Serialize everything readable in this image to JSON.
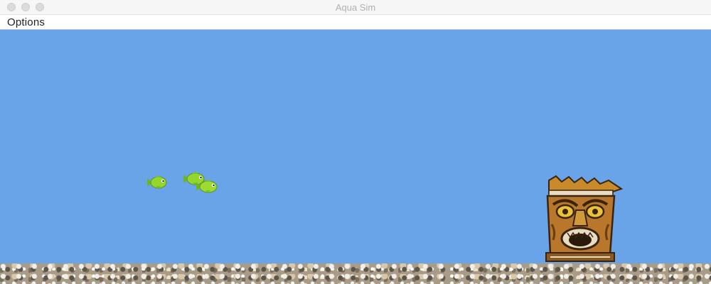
{
  "window": {
    "title": "Aqua Sim"
  },
  "menubar": {
    "items": [
      {
        "label": "Options"
      }
    ]
  },
  "scene": {
    "water_color": "#68a4e7",
    "fish_color": "#8fd42a",
    "fish_count": 3,
    "decorations": [
      "tiki-statue",
      "gravel-floor"
    ]
  }
}
